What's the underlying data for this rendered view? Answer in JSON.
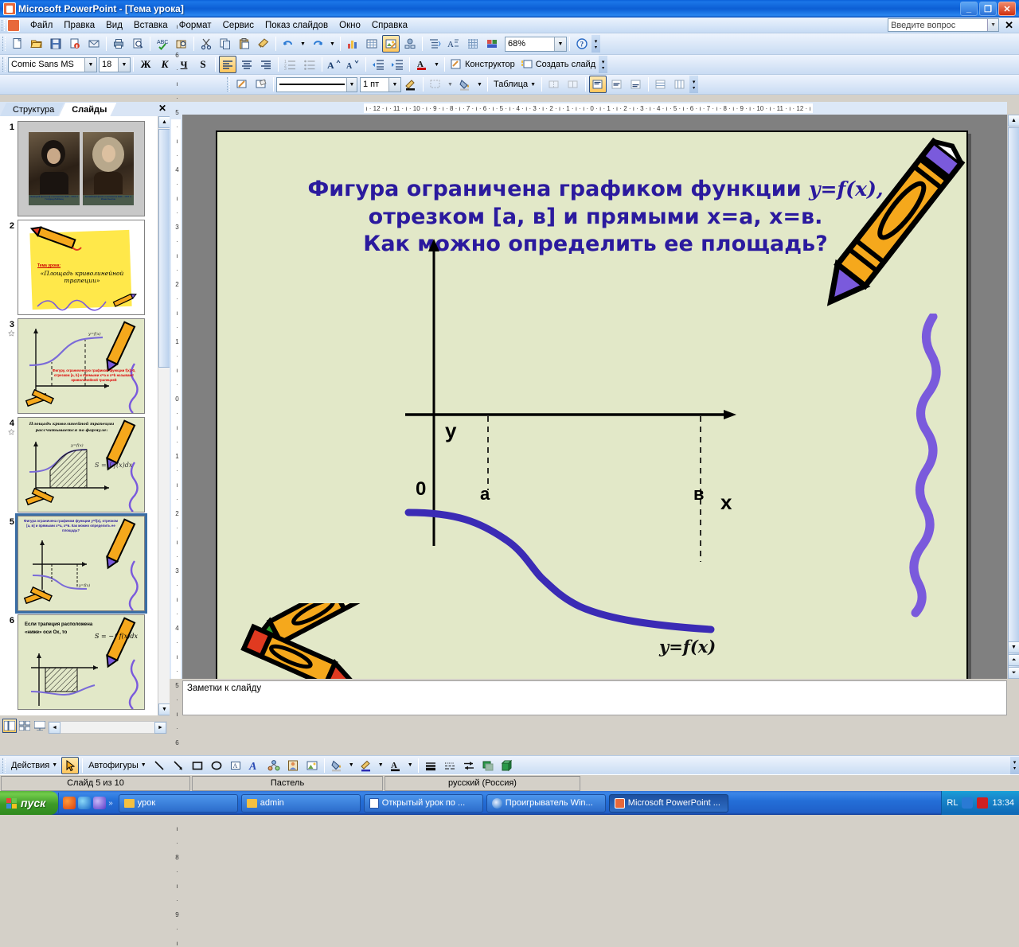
{
  "window": {
    "title": "Microsoft PowerPoint - [Тема урока]",
    "minimize": "_",
    "restore": "❐",
    "close": "✕"
  },
  "menubar": {
    "items": [
      "Файл",
      "Правка",
      "Вид",
      "Вставка",
      "Формат",
      "Сервис",
      "Показ слайдов",
      "Окно",
      "Справка"
    ],
    "ask_placeholder": "Введите вопрос",
    "close_label": "✕"
  },
  "standard_toolbar": {
    "zoom_value": "68%",
    "buttons": [
      "new-icon",
      "open-icon",
      "save-icon",
      "permission-icon",
      "mail-icon",
      "print-icon",
      "print-preview-icon",
      "spelling-icon",
      "research-icon",
      "cut-icon",
      "copy-icon",
      "paste-icon",
      "format-painter-icon",
      "undo-icon",
      "redo-icon",
      "chart-icon",
      "table-icon",
      "insert-picture-icon",
      "insert-diagram-icon",
      "expand-all-icon",
      "show-formatting-icon",
      "grid-icon",
      "color-scheme-icon",
      "help-icon"
    ]
  },
  "formatting_toolbar": {
    "font_name": "Comic Sans MS",
    "font_size": "18",
    "bold": "Ж",
    "italic": "К",
    "underline": "Ч",
    "shadow": "S",
    "design_label": "Конструктор",
    "new_slide_label": "Создать слайд"
  },
  "tables_toolbar": {
    "line_style": "————————",
    "line_weight": "1 пт",
    "table_label": "Таблица"
  },
  "left_pane": {
    "tabs": [
      {
        "label": "Структура",
        "active": false
      },
      {
        "label": "Слайды",
        "active": true
      }
    ],
    "close_label": "✕",
    "slides": [
      {
        "number": "1",
        "kind": "portraits",
        "selected": false,
        "animated": false,
        "captions": [
          "Немецкий философ и математик 1646 – 1716 гг. Готфрид Лейбниц",
          "Английский физик и математик 1643 – 1727 гг. Исаак Ньютон"
        ]
      },
      {
        "number": "2",
        "kind": "theme",
        "selected": false,
        "animated": false,
        "heading": "Тема урока:",
        "text": "«Площадь криволинейной трапеции»"
      },
      {
        "number": "3",
        "kind": "graph-red-text",
        "selected": false,
        "animated": true,
        "text": "Фигуру, ограниченную графиком функции f(x)>0, отрезком [a, b] и прямыми x=a и x=b называют криволинейной трапецией"
      },
      {
        "number": "4",
        "kind": "hatched-area",
        "selected": false,
        "animated": true,
        "heading": "Площадь криволинейной трапеции рассчитывается по формуле:",
        "formula": "S = ∫ f(x)dx"
      },
      {
        "number": "5",
        "kind": "current-slide",
        "selected": true,
        "animated": false,
        "heading": "Фигура ограничена графиком функции y=f(x), отрезком [a, в] и прямыми x=a, x=в. Как можно определить ее площадь?"
      },
      {
        "number": "6",
        "kind": "below-axis",
        "selected": false,
        "animated": false,
        "heading": "Если трапеция расположена «ниже» оси Ох, то",
        "formula": "S = −∫ f(x)dx"
      }
    ]
  },
  "rulers": {
    "horizontal": "ı · 12 · ı · 11 · ı · 10 · ı · 9 · ı · 8 · ı · 7 · ı · 6 · ı · 5 · ı · 4 · ı · 3 · ı · 2 · ı · 1 · ı · ı · 0 · ı · 1 · ı · 2 · ı · 3 · ı · 4 · ı · 5 · ı · 6 · ı · 7 · ı · 8 · ı · 9 · ı · 10 · ı · 11 · ı · 12 · ı",
    "vertical": "ı · 9 · ı · 8 · ı · 7 · ı · 6 · ı · 5 · ı · 4 · ı · 3 · ı · 2 · ı · 1 · ı · 0 · ı · 1 · ı · 2 · ı · 3 · ı · 4 · ı · 5 · ı · 6 · ı · 7 · ı · 8 · ı · 9 · ı"
  },
  "slide": {
    "background_color": "#e2e8c8",
    "text_color": "#2b1a9e",
    "title_lines": [
      "Фигура ограничена графиком функции ",
      "отрезком [а, в] и прямыми х=а, х=в.",
      "Как можно определить ее площадь?"
    ],
    "title_inline_formula": "y=f(x),",
    "graph": {
      "axis_color": "#000000",
      "curve_color": "#3b2bb5",
      "y_axis_label": "y",
      "x_axis_label": "x",
      "origin_label": "0",
      "tick_a": "а",
      "tick_b": "в",
      "curve_label": "y=f(x)"
    },
    "decorations": [
      "crayon-top-right",
      "squiggle-right",
      "crayons-bottom-left"
    ]
  },
  "notes": {
    "placeholder": "Заметки к слайду"
  },
  "drawing_toolbar": {
    "actions_label": "Действия",
    "autoshapes_label": "Автофигуры",
    "tools": [
      "select-arrow-icon",
      "line-icon",
      "arrow-icon",
      "rectangle-icon",
      "oval-icon",
      "textbox-icon",
      "wordart-icon",
      "diagram-icon",
      "clipart-icon",
      "picture-icon",
      "fill-color-icon",
      "line-color-icon",
      "font-color-icon",
      "line-style-icon",
      "dash-style-icon",
      "arrow-style-icon",
      "shadow-style-icon",
      "3d-style-icon"
    ]
  },
  "statusbar": {
    "slide_counter": "Слайд 5 из 10",
    "design_name": "Пастель",
    "language": "русский (Россия)"
  },
  "taskbar": {
    "start_label": "пуск",
    "quicklaunch": [
      "browser-icon",
      "ie-icon",
      "media-icon"
    ],
    "overflow": "»",
    "items": [
      {
        "label": "урок",
        "icon": "folder-icon",
        "active": false
      },
      {
        "label": "admin",
        "icon": "folder-icon",
        "active": false
      },
      {
        "label": "Открытый урок по ...",
        "icon": "word-icon",
        "active": false
      },
      {
        "label": "Проигрыватель Win...",
        "icon": "media-icon",
        "active": false
      },
      {
        "label": "Microsoft PowerPoint ...",
        "icon": "powerpoint-icon",
        "active": true
      }
    ],
    "tray_language": "RL",
    "tray_icons": [
      "volume-icon",
      "kaspersky-icon"
    ],
    "clock": "13:34"
  }
}
